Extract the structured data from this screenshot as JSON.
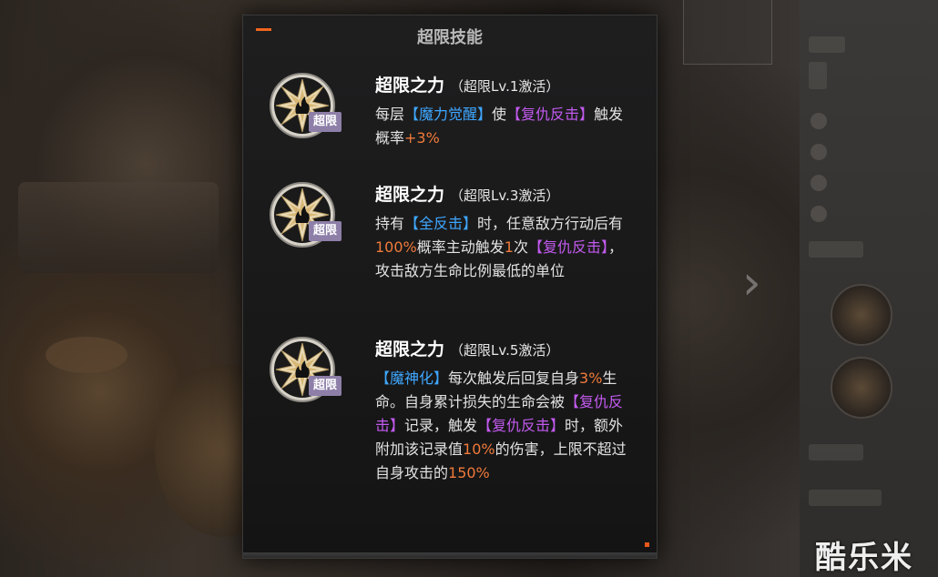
{
  "modal": {
    "title": "超限技能",
    "skills": [
      {
        "name": "超限之力",
        "level": "（超限Lv.1激活）",
        "tag": "超限",
        "desc": [
          {
            "t": "每层",
            "c": "plain"
          },
          {
            "t": "【魔力觉醒】",
            "c": "blue"
          },
          {
            "t": "使",
            "c": "plain"
          },
          {
            "t": "【复仇反击】",
            "c": "purple"
          },
          {
            "t": "触发概率",
            "c": "plain"
          },
          {
            "t": "+3%",
            "c": "orange"
          }
        ]
      },
      {
        "name": "超限之力",
        "level": "（超限Lv.3激活）",
        "tag": "超限",
        "desc": [
          {
            "t": "持有",
            "c": "plain"
          },
          {
            "t": "【全反击】",
            "c": "blue"
          },
          {
            "t": "时，任意敌方行动后有",
            "c": "plain"
          },
          {
            "t": "100%",
            "c": "orange"
          },
          {
            "t": "概率主动触发",
            "c": "plain"
          },
          {
            "t": "1",
            "c": "orange"
          },
          {
            "t": "次",
            "c": "plain"
          },
          {
            "t": "【复仇反击】",
            "c": "purple"
          },
          {
            "t": "，攻击敌方生命比例最低的单位",
            "c": "plain"
          }
        ]
      },
      {
        "name": "超限之力",
        "level": "（超限Lv.5激活）",
        "tag": "超限",
        "desc": [
          {
            "t": "【魔神化】",
            "c": "blue"
          },
          {
            "t": "每次触发后回复自身",
            "c": "plain"
          },
          {
            "t": "3%",
            "c": "orange"
          },
          {
            "t": "生命。自身累计损失的生命会被",
            "c": "plain"
          },
          {
            "t": "【复仇反击】",
            "c": "purple"
          },
          {
            "t": "记录，触发",
            "c": "plain"
          },
          {
            "t": "【复仇反击】",
            "c": "purple"
          },
          {
            "t": "时，额外附加该记录值",
            "c": "plain"
          },
          {
            "t": "10%",
            "c": "orange"
          },
          {
            "t": "的伤害，上限不超过自身攻击的",
            "c": "plain"
          },
          {
            "t": "150%",
            "c": "orange"
          }
        ]
      }
    ]
  },
  "watermark": "酷乐米",
  "colors": {
    "blue": "#3fa7ff",
    "purple": "#c35af0",
    "orange": "#f07a3a",
    "accent": "#f0651e"
  }
}
